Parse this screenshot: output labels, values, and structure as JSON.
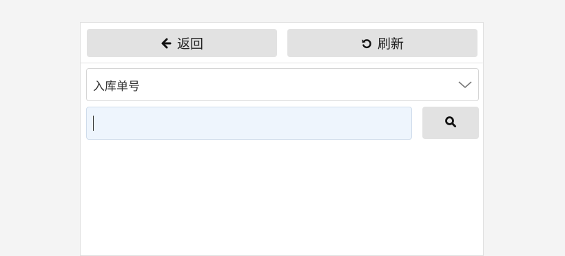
{
  "toolbar": {
    "back_label": "返回",
    "refresh_label": "刷新"
  },
  "filter": {
    "selected": "入库单号"
  },
  "search": {
    "value": "",
    "placeholder": ""
  },
  "icons": {
    "back": "arrow-left-icon",
    "refresh": "rotate-ccw-icon",
    "dropdown": "chevron-down-icon",
    "search": "search-icon"
  }
}
